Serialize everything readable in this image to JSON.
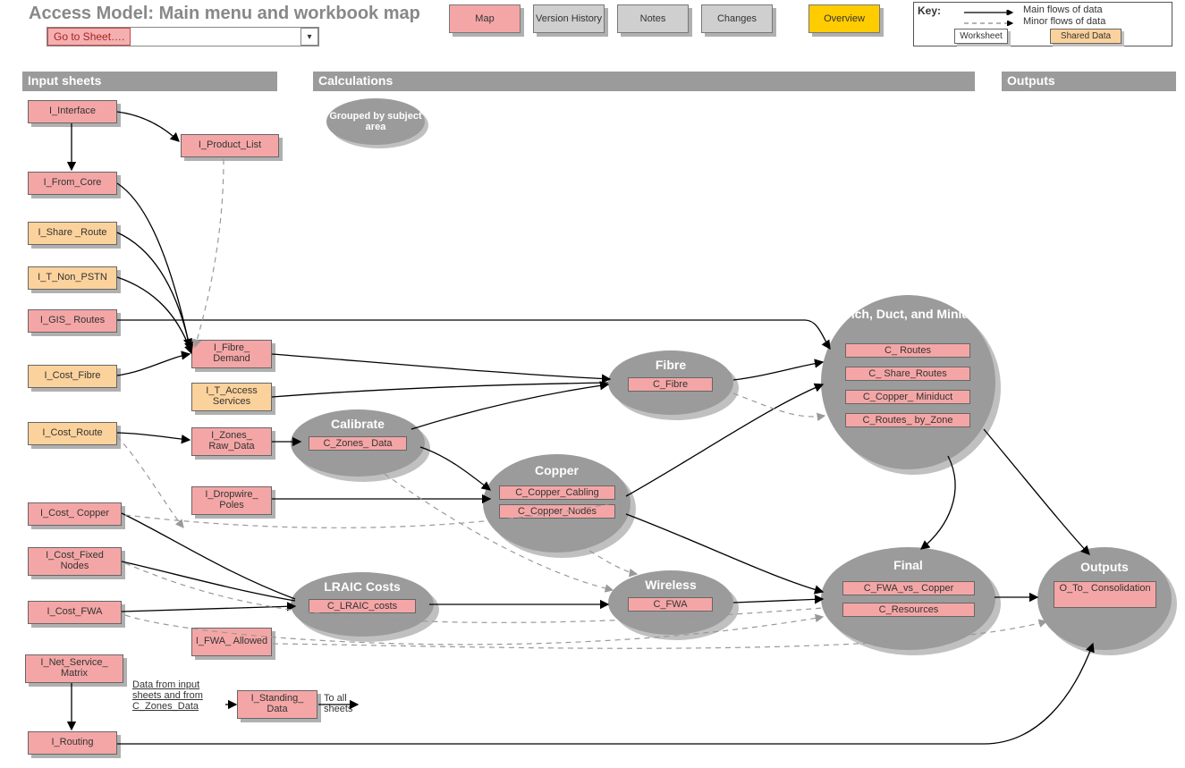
{
  "title": "Access Model:  Main menu and workbook map",
  "goto_button": "Go to Sheet….",
  "top_buttons": {
    "map": "Map",
    "version": "Version History",
    "notes": "Notes",
    "changes": "Changes",
    "overview": "Overview"
  },
  "key": {
    "label": "Key:",
    "main": "Main flows of data",
    "minor": "Minor flows of data",
    "worksheet": "Worksheet",
    "shared": "Shared Data"
  },
  "sections": {
    "inputs": "Input sheets",
    "calcs": "Calculations",
    "outputs": "Outputs"
  },
  "subject_ellipse": "Grouped by subject area",
  "input_boxes": {
    "i_interface": "I_Interface",
    "i_product_list": "I_Product_List",
    "i_from_core": "I_From_Core",
    "i_share_route": "I_Share _Route",
    "i_t_non_pstn": "I_T_Non_PSTN",
    "i_gis_routes": "I_GIS_ Routes",
    "i_cost_fibre": "I_Cost_Fibre",
    "i_cost_route": "I_Cost_Route",
    "i_fibre_demand": "I_Fibre_ Demand",
    "i_t_access_services": "I_T_Access Services",
    "i_zones_raw": "I_Zones_ Raw_Data",
    "i_dropwire_poles": "I_Dropwire_ Poles",
    "i_cost_copper": "I_Cost_ Copper",
    "i_cost_fixed_nodes": "I_Cost_Fixed Nodes",
    "i_cost_fwa": "I_Cost_FWA",
    "i_fwa_allowed": "I_FWA_ Allowed",
    "i_net_service_matrix": "I_Net_Service_ Matrix",
    "i_standing_data": "I_Standing_ Data",
    "i_routing": "I_Routing"
  },
  "groups": {
    "calibrate": {
      "title": "Calibrate",
      "items": [
        "C_Zones_ Data"
      ]
    },
    "copper": {
      "title": "Copper",
      "items": [
        "C_Copper_Cabling",
        "C_Copper_Nodes"
      ]
    },
    "fibre": {
      "title": "Fibre",
      "items": [
        "C_Fibre"
      ]
    },
    "wireless": {
      "title": "Wireless",
      "items": [
        "C_FWA"
      ]
    },
    "lraic": {
      "title": "LRAIC Costs",
      "items": [
        "C_LRAIC_costs"
      ]
    },
    "trench": {
      "title": "Trench, Duct, and Miniduct",
      "items": [
        "C_ Routes",
        "C_ Share_Routes",
        "C_Copper_ Miniduct",
        "C_Routes_ by_Zone"
      ]
    },
    "final": {
      "title": "Final",
      "items": [
        "C_FWA_vs_ Copper",
        "C_Resources"
      ]
    },
    "outputs": {
      "title": "Outputs",
      "items": [
        "O_To_ Consolidation"
      ]
    }
  },
  "annotations": {
    "from_inputs": "Data from input sheets and from C_Zones_Data",
    "to_all": "To all sheets"
  }
}
